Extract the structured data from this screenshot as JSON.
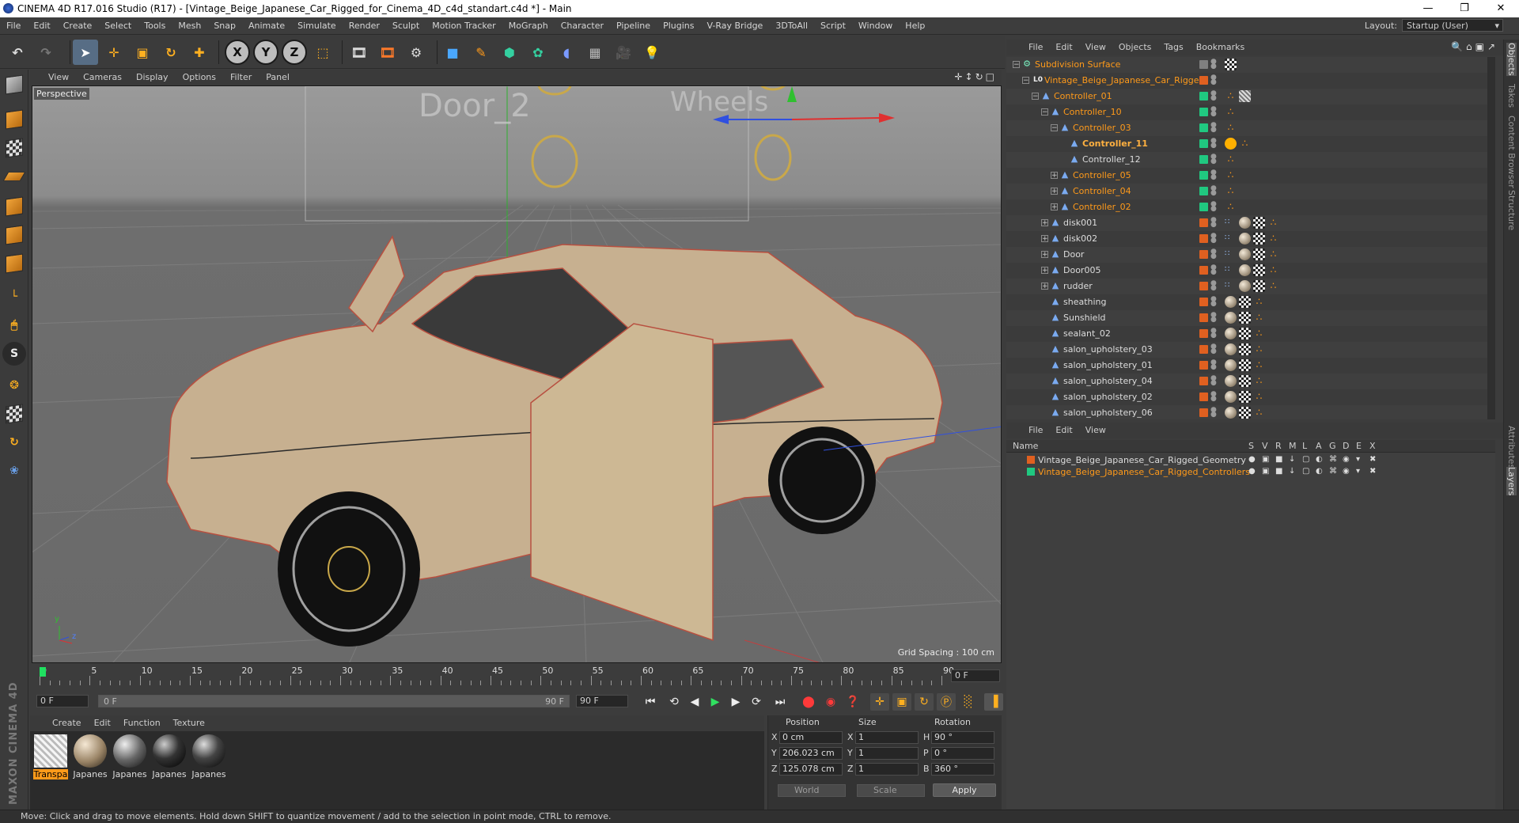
{
  "window": {
    "title": "CINEMA 4D R17.016 Studio (R17) - [Vintage_Beige_Japanese_Car_Rigged_for_Cinema_4D_c4d_standart.c4d *] - Main",
    "minimize": "—",
    "maximize": "❐",
    "close": "✕"
  },
  "menu": [
    "File",
    "Edit",
    "Create",
    "Select",
    "Tools",
    "Mesh",
    "Snap",
    "Animate",
    "Simulate",
    "Render",
    "Sculpt",
    "Motion Tracker",
    "MoGraph",
    "Character",
    "Pipeline",
    "Plugins",
    "V-Ray Bridge",
    "3DToAll",
    "Script",
    "Window",
    "Help"
  ],
  "layout": {
    "label": "Layout:",
    "value": "Startup (User)"
  },
  "toolbar": {
    "x_label": "X",
    "y_label": "Y",
    "z_label": "Z"
  },
  "viewport": {
    "menu": [
      "View",
      "Cameras",
      "Display",
      "Options",
      "Filter",
      "Panel"
    ],
    "label": "Perspective",
    "grid_spacing": "Grid Spacing : 100 cm",
    "text_door": "Door_2",
    "text_wheels": "Wheels",
    "axis_y": "y",
    "axis_z": "z"
  },
  "timeline": {
    "ticks": [
      "0",
      "5",
      "10",
      "15",
      "20",
      "25",
      "30",
      "35",
      "40",
      "45",
      "50",
      "55",
      "60",
      "65",
      "70",
      "75",
      "80",
      "85",
      "90"
    ],
    "current_frame": "0 F",
    "start": "0 F",
    "range_start": "0 F",
    "range_end": "90 F",
    "end": "90 F"
  },
  "material_menu": [
    "Create",
    "Edit",
    "Function",
    "Texture"
  ],
  "materials": [
    {
      "name": "Transpa",
      "selected": true
    },
    {
      "name": "Japanes",
      "selected": false
    },
    {
      "name": "Japanes",
      "selected": false
    },
    {
      "name": "Japanes",
      "selected": false
    },
    {
      "name": "Japanes",
      "selected": false
    }
  ],
  "brand": "MAXON CINEMA 4D",
  "coords": {
    "headers": {
      "position": "Position",
      "size": "Size",
      "rotation": "Rotation"
    },
    "rows": [
      {
        "axis": "X",
        "pos": "0 cm",
        "saxis": "X",
        "size": "1",
        "raxis": "H",
        "rot": "90 °"
      },
      {
        "axis": "Y",
        "pos": "206.023 cm",
        "saxis": "Y",
        "size": "1",
        "raxis": "P",
        "rot": "0 °"
      },
      {
        "axis": "Z",
        "pos": "125.078 cm",
        "saxis": "Z",
        "size": "1",
        "raxis": "B",
        "rot": "360 °"
      }
    ],
    "space": "World",
    "mode": "Scale",
    "apply": "Apply"
  },
  "status": "Move: Click and drag to move elements. Hold down SHIFT to quantize movement / add to the selection in point mode, CTRL to remove.",
  "object_menu": [
    "File",
    "Edit",
    "View",
    "Objects",
    "Tags",
    "Bookmarks"
  ],
  "objects": [
    {
      "name": "Subdivision Surface",
      "depth": 0,
      "color": "orange",
      "icon": "⚙",
      "plus": "−",
      "layer": "#808080",
      "tags": [
        "check"
      ]
    },
    {
      "name": "Vintage_Beige_Japanese_Car_Rigged",
      "depth": 1,
      "color": "orange",
      "icon": "L0",
      "plus": "−",
      "layer": "#e06020",
      "tags": []
    },
    {
      "name": "Controller_01",
      "depth": 2,
      "color": "orange",
      "icon": "▲",
      "plus": "−",
      "layer": "#20c880",
      "tags": [
        "xpress",
        "hatch"
      ]
    },
    {
      "name": "Controller_10",
      "depth": 3,
      "color": "orange",
      "icon": "▲",
      "plus": "−",
      "layer": "#20c880",
      "tags": [
        "xpress"
      ]
    },
    {
      "name": "Controller_03",
      "depth": 4,
      "color": "orange",
      "icon": "▲",
      "plus": "−",
      "layer": "#20c880",
      "tags": [
        "xpress"
      ]
    },
    {
      "name": "Controller_11",
      "depth": 5,
      "color": "bold",
      "icon": "▲",
      "plus": "",
      "layer": "#20c880",
      "tags": [
        "stop",
        "xpress"
      ]
    },
    {
      "name": "Controller_12",
      "depth": 5,
      "color": "white",
      "icon": "▲",
      "plus": "",
      "layer": "#20c880",
      "tags": [
        "xpress"
      ]
    },
    {
      "name": "Controller_05",
      "depth": 4,
      "color": "orange",
      "icon": "▲",
      "plus": "+",
      "layer": "#20c880",
      "tags": [
        "xpress"
      ]
    },
    {
      "name": "Controller_04",
      "depth": 4,
      "color": "orange",
      "icon": "▲",
      "plus": "+",
      "layer": "#20c880",
      "tags": [
        "xpress"
      ]
    },
    {
      "name": "Controller_02",
      "depth": 4,
      "color": "orange",
      "icon": "▲",
      "plus": "+",
      "layer": "#20c880",
      "tags": [
        "xpress"
      ]
    },
    {
      "name": "disk001",
      "depth": 3,
      "color": "white",
      "icon": "▲",
      "plus": "+",
      "layer": "#e06020",
      "tags": [
        "dots2",
        "mat",
        "check",
        "xpress"
      ]
    },
    {
      "name": "disk002",
      "depth": 3,
      "color": "white",
      "icon": "▲",
      "plus": "+",
      "layer": "#e06020",
      "tags": [
        "dots2",
        "mat",
        "check",
        "xpress"
      ]
    },
    {
      "name": "Door",
      "depth": 3,
      "color": "white",
      "icon": "▲",
      "plus": "+",
      "layer": "#e06020",
      "tags": [
        "dots2",
        "mat",
        "check",
        "xpress"
      ]
    },
    {
      "name": "Door005",
      "depth": 3,
      "color": "white",
      "icon": "▲",
      "plus": "+",
      "layer": "#e06020",
      "tags": [
        "dots2",
        "mat",
        "check",
        "xpress"
      ]
    },
    {
      "name": "rudder",
      "depth": 3,
      "color": "white",
      "icon": "▲",
      "plus": "+",
      "layer": "#e06020",
      "tags": [
        "dots2",
        "mat",
        "check",
        "xpress"
      ]
    },
    {
      "name": "sheathing",
      "depth": 3,
      "color": "white",
      "icon": "▲",
      "plus": "",
      "layer": "#e06020",
      "tags": [
        "mat",
        "check",
        "xpress"
      ]
    },
    {
      "name": "Sunshield",
      "depth": 3,
      "color": "white",
      "icon": "▲",
      "plus": "",
      "layer": "#e06020",
      "tags": [
        "mat",
        "check",
        "xpress"
      ]
    },
    {
      "name": "sealant_02",
      "depth": 3,
      "color": "white",
      "icon": "▲",
      "plus": "",
      "layer": "#e06020",
      "tags": [
        "mat",
        "check",
        "xpress"
      ]
    },
    {
      "name": "salon_upholstery_03",
      "depth": 3,
      "color": "white",
      "icon": "▲",
      "plus": "",
      "layer": "#e06020",
      "tags": [
        "mat",
        "check",
        "xpress"
      ]
    },
    {
      "name": "salon_upholstery_01",
      "depth": 3,
      "color": "white",
      "icon": "▲",
      "plus": "",
      "layer": "#e06020",
      "tags": [
        "mat",
        "check",
        "xpress"
      ]
    },
    {
      "name": "salon_upholstery_04",
      "depth": 3,
      "color": "white",
      "icon": "▲",
      "plus": "",
      "layer": "#e06020",
      "tags": [
        "mat",
        "check",
        "xpress"
      ]
    },
    {
      "name": "salon_upholstery_02",
      "depth": 3,
      "color": "white",
      "icon": "▲",
      "plus": "",
      "layer": "#e06020",
      "tags": [
        "mat",
        "check",
        "xpress"
      ]
    },
    {
      "name": "salon_upholstery_06",
      "depth": 3,
      "color": "white",
      "icon": "▲",
      "plus": "",
      "layer": "#e06020",
      "tags": [
        "mat",
        "check",
        "xpress"
      ]
    }
  ],
  "layer_menu": [
    "File",
    "Edit",
    "View"
  ],
  "layer_headers": [
    "Name",
    "S",
    "V",
    "R",
    "M",
    "L",
    "A",
    "G",
    "D",
    "E",
    "X"
  ],
  "layers": [
    {
      "name": "Vintage_Beige_Japanese_Car_Rigged_Geometry",
      "color": "#e06020",
      "text": "#dcdcdc"
    },
    {
      "name": "Vintage_Beige_Japanese_Car_Rigged_Controllers",
      "color": "#20c880",
      "text": "#ff9a1a"
    }
  ],
  "right_tabs": [
    "Objects",
    "Takes",
    "Content Browser",
    "Structure",
    "Attributes",
    "Layers"
  ],
  "colors": {
    "accent": "#ff9a1a",
    "selection": "#576d85",
    "controller": "#20c880",
    "geometry": "#e06020"
  }
}
